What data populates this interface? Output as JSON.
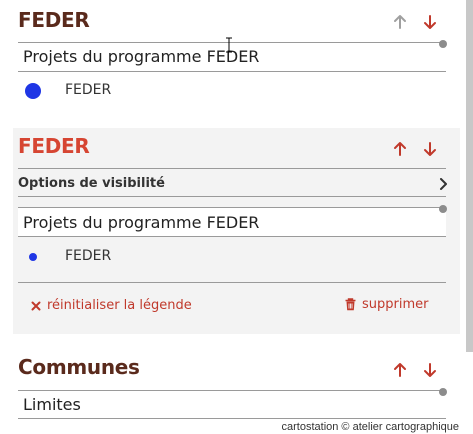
{
  "layers": [
    {
      "title": "FEDER",
      "subtitle": "Projets du programme FEDER",
      "legend_label": "FEDER",
      "legend_color": "#1f36e5"
    },
    {
      "title": "FEDER",
      "options_label": "Options de visibilité",
      "subtitle": "Projets du programme FEDER",
      "legend_label": "FEDER",
      "legend_color": "#1f36e5",
      "reset_label": "réinitialiser la légende",
      "delete_label": "supprimer"
    },
    {
      "title": "Communes",
      "subtitle": "Limites"
    }
  ],
  "colors": {
    "title_dark": "#5a2a1c",
    "title_active": "#d64532",
    "arrow_active": "#c0392b",
    "arrow_disabled": "#a0a0a0",
    "card_bg": "#f3f3f3"
  },
  "icons": {
    "up": "arrow-up-icon",
    "down": "arrow-down-icon",
    "chevron": "chevron-right-icon",
    "close": "close-icon",
    "trash": "trash-icon"
  },
  "footer": {
    "credit": "cartostation © atelier cartographique"
  }
}
